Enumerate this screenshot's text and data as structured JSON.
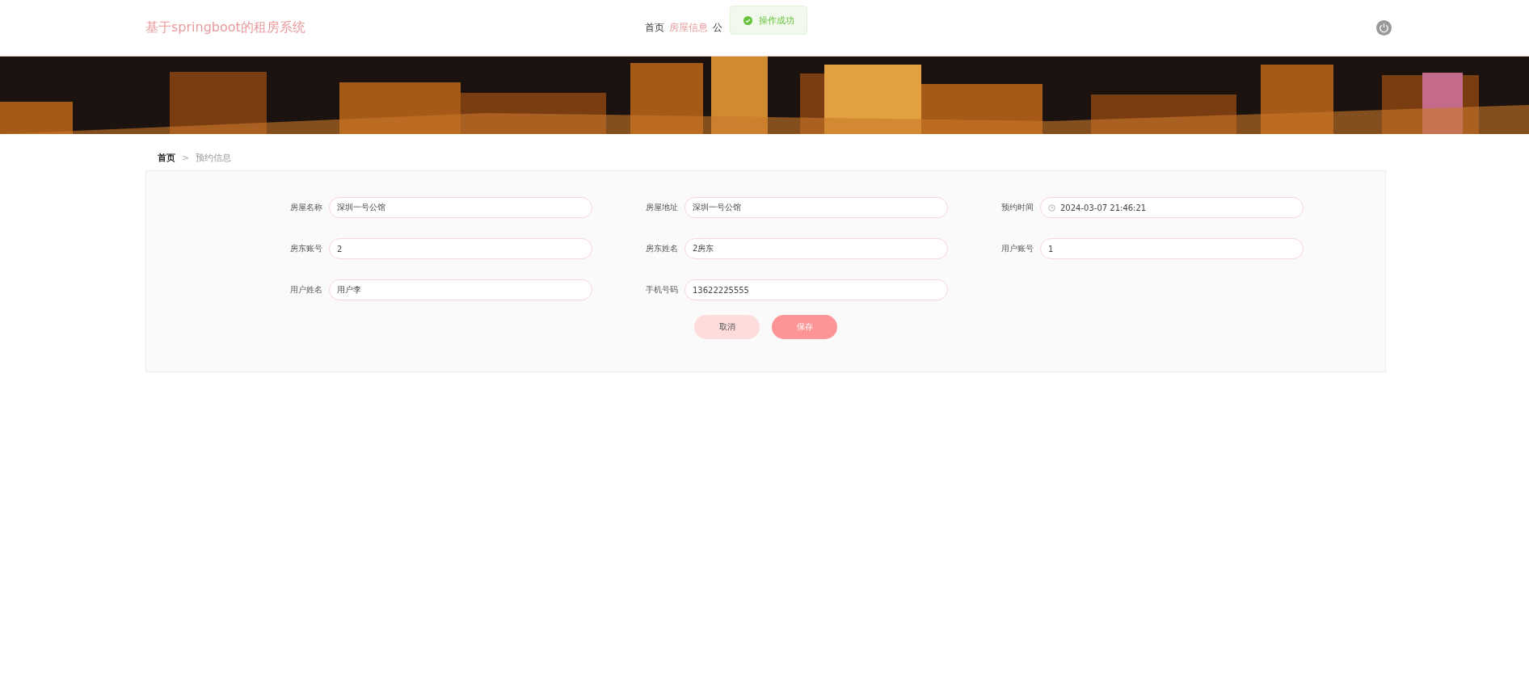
{
  "header": {
    "title": "基于springboot的租房系统",
    "nav": [
      {
        "label": "首页",
        "selected": false
      },
      {
        "label": "房屋信息",
        "selected": true
      },
      {
        "label": "公",
        "selected": false
      }
    ]
  },
  "toast": {
    "kind": "success",
    "message": "操作成功"
  },
  "breadcrumb": [
    {
      "label": "首页",
      "current": false
    },
    {
      "label": "预约信息",
      "current": true
    }
  ],
  "breadcrumb_separator": ">",
  "form": {
    "fields": [
      {
        "label": "房屋名称",
        "value": "深圳一号公馆",
        "kind": "text"
      },
      {
        "label": "房屋地址",
        "value": "深圳一号公馆",
        "kind": "text"
      },
      {
        "label": "预约时间",
        "value": "2024-03-07 21:46:21",
        "kind": "datetime"
      },
      {
        "label": "房东账号",
        "value": "2",
        "kind": "text"
      },
      {
        "label": "房东姓名",
        "value": "2房东",
        "kind": "text"
      },
      {
        "label": "用户账号",
        "value": "1",
        "kind": "text"
      },
      {
        "label": "用户姓名",
        "value": "用户李",
        "kind": "text"
      },
      {
        "label": "手机号码",
        "value": "13622225555",
        "kind": "text"
      }
    ],
    "buttons": [
      {
        "label": "取消",
        "kind": "secondary"
      },
      {
        "label": "保存",
        "kind": "primary"
      }
    ]
  }
}
